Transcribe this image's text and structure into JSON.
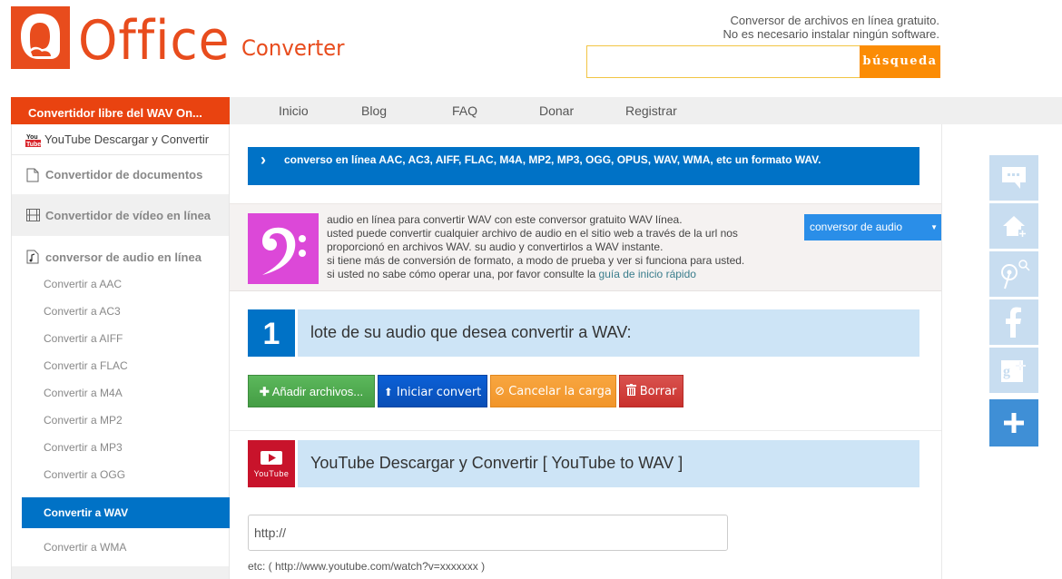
{
  "header": {
    "logo_word": "Office",
    "logo_sub": "Converter",
    "tagline_line1": "Conversor de archivos en línea gratuito.",
    "tagline_line2": "No es necesario instalar ningún software.",
    "search_placeholder": "",
    "search_value": "",
    "search_button": "búsqueda"
  },
  "nav": {
    "items": [
      "Inicio",
      "Blog",
      "FAQ",
      "Donar",
      "Registrar"
    ]
  },
  "sidebar": {
    "title": "Convertidor libre del WAV On...",
    "categories": [
      {
        "label": "YouTube Descargar y Convertir",
        "icon": "youtube-icon"
      },
      {
        "label": "Convertidor de documentos",
        "icon": "document-icon"
      },
      {
        "label": "Convertidor de vídeo en línea",
        "icon": "film-icon"
      },
      {
        "label": "conversor de audio en línea",
        "icon": "audio-file-icon"
      }
    ],
    "audio_items": [
      "Convertir a AAC",
      "Convertir a AC3",
      "Convertir a AIFF",
      "Convertir a FLAC",
      "Convertir a M4A",
      "Convertir a MP2",
      "Convertir a MP3",
      "Convertir a OGG",
      "Convertir a WAV",
      "Convertir a WMA"
    ],
    "active_item": "Convertir a WAV"
  },
  "main": {
    "banner": "conversо en línea AAC, AC3, AIFF, FLAC, M4A, MP2, MP3, OGG, OPUS, WAV, WMA, etc un formato WAV.",
    "info_lines": [
      "audio en línea para convertir WAV con este conversor gratuito WAV línea.",
      "usted puede convertir cualquier archivo de audio en el sitio web a través de la url nos",
      "proporcionó en archivos WAV. su audio y convertirlos a WAV instante.",
      "si tiene más de conversión de formato, a modo de prueba y ver si funciona para usted."
    ],
    "info_last_prefix": "si usted no sabe cómo operar una, por favor consulte la ",
    "info_link": "guía de inicio rápido",
    "dropdown_selected": "conversor de audio",
    "step_number": "1",
    "step_title": "lote de su audio que desea convertir a WAV:",
    "buttons": {
      "add": "Añadir archivos...",
      "start": "Iniciar convert",
      "cancel": "Cancelar la carga",
      "delete": "Borrar"
    },
    "youtube_logo_text": "YouTube",
    "youtube_title": "YouTube Descargar y Convertir [ YouTube to WAV ]",
    "url_value": "http://",
    "url_hint": "etc: ( http://www.youtube.com/watch?v=xxxxxxx )"
  },
  "social_rail": [
    "comment-icon",
    "home-add-icon",
    "pinterest-search-icon",
    "facebook-icon",
    "google-plus-icon",
    "plus-icon"
  ],
  "colors": {
    "brand_orange": "#e84c1d",
    "accent_blue": "#0072c6",
    "search_orange": "#fb8c05",
    "light_blue": "#cde4f6"
  }
}
